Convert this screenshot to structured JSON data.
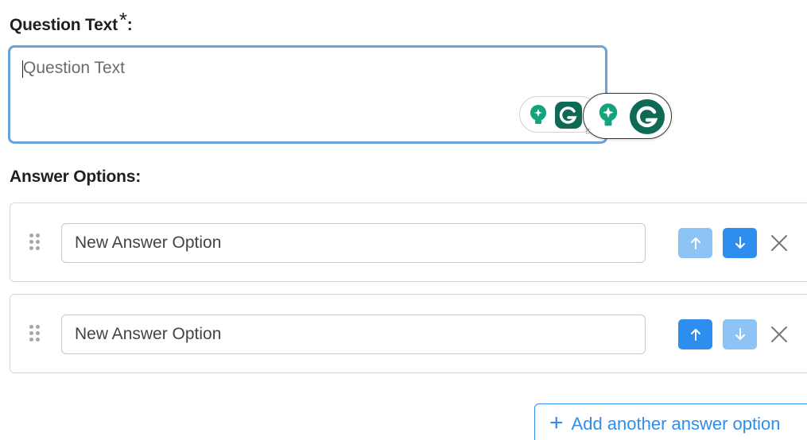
{
  "question": {
    "label": "Question Text",
    "required_marker": "*",
    "label_suffix": ":",
    "placeholder": "Question Text"
  },
  "answers": {
    "label": "Answer Options:",
    "options": [
      {
        "value": "New Answer Option",
        "up_enabled": false,
        "down_enabled": true
      },
      {
        "value": "New Answer Option",
        "up_enabled": true,
        "down_enabled": false
      }
    ],
    "add_label": "Add another answer option"
  },
  "icons": {
    "drag": "drag-handle-icon",
    "up": "arrow-up-icon",
    "down": "arrow-down-icon",
    "remove": "close-icon",
    "add": "plus-icon",
    "grammarly": "grammarly-icon",
    "suggestion": "lightbulb-icon"
  },
  "colors": {
    "accent": "#2d8ef0",
    "accent_disabled": "#8ec3f5",
    "focus_border": "#6aa3dc",
    "grammarly_green": "#15a37f",
    "grammarly_dark": "#0f6a55"
  }
}
